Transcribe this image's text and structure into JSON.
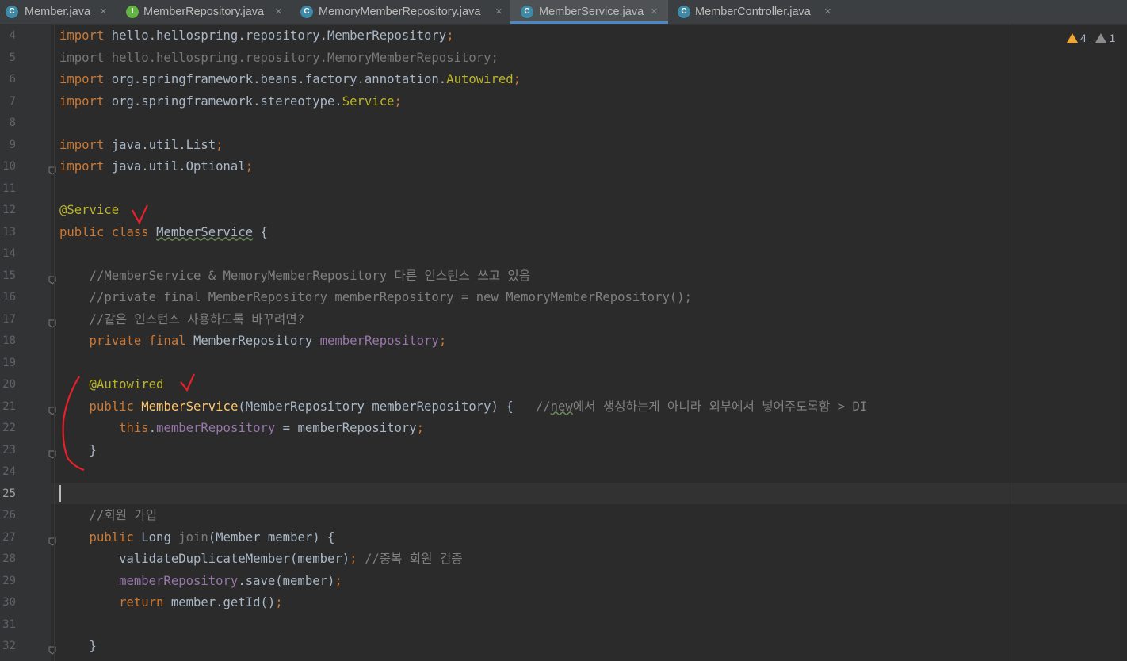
{
  "tabs": [
    {
      "label": "Member.java",
      "icon": "class-icon",
      "icon_glyph": "C"
    },
    {
      "label": "MemberRepository.java",
      "icon": "interface-icon",
      "icon_glyph": "I"
    },
    {
      "label": "MemoryMemberRepository.java",
      "icon": "class-icon",
      "icon_glyph": "C"
    },
    {
      "label": "MemberService.java",
      "icon": "class-icon",
      "icon_glyph": "C",
      "active": true
    },
    {
      "label": "MemberController.java",
      "icon": "class-icon",
      "icon_glyph": "C"
    }
  ],
  "tab_close_glyph": "×",
  "inspections": {
    "warnings": "4",
    "weak_warnings": "1"
  },
  "editor": {
    "current_line": 25,
    "lines": [
      {
        "num": "4",
        "segments": [
          {
            "t": "import ",
            "c": "kw"
          },
          {
            "t": "hello.hellospring.repository.MemberRepository",
            "c": ""
          },
          {
            "t": ";",
            "c": "kw"
          }
        ]
      },
      {
        "num": "5",
        "segments": [
          {
            "t": "import hello.hellospring.repository.MemoryMemberRepository;",
            "c": "gray"
          }
        ]
      },
      {
        "num": "6",
        "segments": [
          {
            "t": "import ",
            "c": "kw"
          },
          {
            "t": "org.springframework.beans.factory.annotation.",
            "c": ""
          },
          {
            "t": "Autowired",
            "c": "an"
          },
          {
            "t": ";",
            "c": "kw"
          }
        ]
      },
      {
        "num": "7",
        "segments": [
          {
            "t": "import ",
            "c": "kw"
          },
          {
            "t": "org.springframework.stereotype.",
            "c": ""
          },
          {
            "t": "Service",
            "c": "an"
          },
          {
            "t": ";",
            "c": "kw"
          }
        ]
      },
      {
        "num": "8",
        "segments": []
      },
      {
        "num": "9",
        "segments": [
          {
            "t": "import ",
            "c": "kw"
          },
          {
            "t": "java.util.List",
            "c": ""
          },
          {
            "t": ";",
            "c": "kw"
          }
        ]
      },
      {
        "num": "10",
        "segments": [
          {
            "t": "import ",
            "c": "kw"
          },
          {
            "t": "java.util.Optional",
            "c": ""
          },
          {
            "t": ";",
            "c": "kw"
          }
        ]
      },
      {
        "num": "11",
        "segments": []
      },
      {
        "num": "12",
        "segments": [
          {
            "t": "@Service",
            "c": "an"
          }
        ]
      },
      {
        "num": "13",
        "segments": [
          {
            "t": "public class ",
            "c": "kw"
          },
          {
            "t": "MemberService",
            "c": "squig"
          },
          {
            "t": " {",
            "c": ""
          }
        ]
      },
      {
        "num": "14",
        "segments": []
      },
      {
        "num": "15",
        "segments": [
          {
            "t": "    //MemberService & MemoryMemberRepository 다른 인스턴스 쓰고 있음",
            "c": "cm"
          }
        ]
      },
      {
        "num": "16",
        "segments": [
          {
            "t": "    //private final MemberRepository memberRepository = new MemoryMemberRepository();",
            "c": "cm"
          }
        ]
      },
      {
        "num": "17",
        "segments": [
          {
            "t": "    //같은 인스턴스 사용하도록 바꾸려면?",
            "c": "cm"
          }
        ]
      },
      {
        "num": "18",
        "segments": [
          {
            "t": "    private final ",
            "c": "kw"
          },
          {
            "t": "MemberRepository ",
            "c": ""
          },
          {
            "t": "memberRepository",
            "c": "fd"
          },
          {
            "t": ";",
            "c": "kw"
          }
        ]
      },
      {
        "num": "19",
        "segments": []
      },
      {
        "num": "20",
        "segments": [
          {
            "t": "    @Autowired",
            "c": "an"
          }
        ]
      },
      {
        "num": "21",
        "segments": [
          {
            "t": "    public ",
            "c": "kw"
          },
          {
            "t": "MemberService",
            "c": "fn"
          },
          {
            "t": "(MemberRepository memberRepository) {   ",
            "c": ""
          },
          {
            "t": "//",
            "c": "cm"
          },
          {
            "t": "new",
            "c": "cm squig"
          },
          {
            "t": "에서 생성하는게 아니라 외부에서 넣어주도록함 > DI",
            "c": "cm"
          }
        ]
      },
      {
        "num": "22",
        "segments": [
          {
            "t": "        this",
            "c": "kw"
          },
          {
            "t": ".",
            "c": ""
          },
          {
            "t": "memberRepository",
            "c": "fd"
          },
          {
            "t": " = memberRepository",
            "c": ""
          },
          {
            "t": ";",
            "c": "kw"
          }
        ]
      },
      {
        "num": "23",
        "segments": [
          {
            "t": "    }",
            "c": ""
          }
        ]
      },
      {
        "num": "24",
        "segments": []
      },
      {
        "num": "25",
        "segments": []
      },
      {
        "num": "26",
        "segments": [
          {
            "t": "    //회원 가입",
            "c": "cm"
          }
        ]
      },
      {
        "num": "27",
        "segments": [
          {
            "t": "    public ",
            "c": "kw"
          },
          {
            "t": "Long ",
            "c": ""
          },
          {
            "t": "join",
            "c": "gray"
          },
          {
            "t": "(Member member) {",
            "c": ""
          }
        ]
      },
      {
        "num": "28",
        "segments": [
          {
            "t": "        validateDuplicateMember(member)",
            "c": ""
          },
          {
            "t": "; ",
            "c": "kw"
          },
          {
            "t": "//중복 회원 검증",
            "c": "cm"
          }
        ]
      },
      {
        "num": "29",
        "segments": [
          {
            "t": "        memberRepository",
            "c": "fd"
          },
          {
            "t": ".save(member)",
            "c": ""
          },
          {
            "t": ";",
            "c": "kw"
          }
        ]
      },
      {
        "num": "30",
        "segments": [
          {
            "t": "        return ",
            "c": "kw"
          },
          {
            "t": "member.getId()",
            "c": ""
          },
          {
            "t": ";",
            "c": "kw"
          }
        ]
      },
      {
        "num": "31",
        "segments": []
      },
      {
        "num": "32",
        "segments": [
          {
            "t": "    }",
            "c": ""
          }
        ]
      }
    ]
  }
}
